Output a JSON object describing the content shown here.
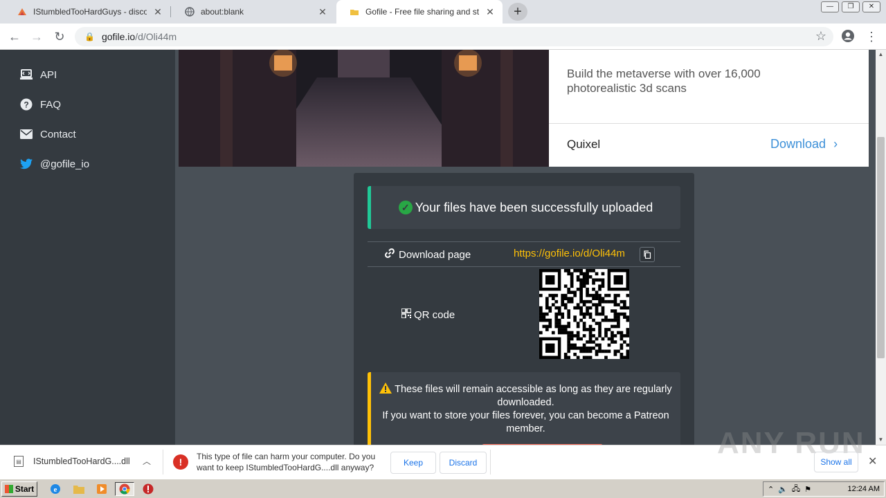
{
  "browser": {
    "tabs": [
      {
        "title": "IStumbledTooHardGuys - discord.gg",
        "favicon": "anyrun-icon",
        "active": false
      },
      {
        "title": "about:blank",
        "favicon": "globe-icon",
        "active": false
      },
      {
        "title": "Gofile - Free file sharing and storage",
        "favicon": "gofile-icon",
        "active": true
      }
    ],
    "newtab_label": "+",
    "url_host": "gofile.io",
    "url_path": "/d/Oli44m"
  },
  "sidebar": {
    "items": [
      {
        "label": "API",
        "icon": "laptop-icon"
      },
      {
        "label": "FAQ",
        "icon": "question-icon"
      },
      {
        "label": "Contact",
        "icon": "envelope-icon"
      },
      {
        "label": "@gofile_io",
        "icon": "twitter-icon"
      }
    ]
  },
  "ad": {
    "text": "Build the metaverse with over 16,000 photorealistic 3d scans",
    "brand": "Quixel",
    "cta": "Download"
  },
  "upload": {
    "success_message": "Your files have been successfully uploaded",
    "download_page_label": "Download page",
    "download_url": "https://gofile.io/d/Oli44m",
    "qr_label": "QR code",
    "warning_line1": "These files will remain accessible as long as they are regularly downloaded.",
    "warning_line2": "If you want to store your files forever, you can become a Patreon member."
  },
  "download_bar": {
    "file_name": "IStumbledTooHardG....dll",
    "message": "This type of file can harm your computer. Do you want to keep IStumbledTooHardG....dll anyway?",
    "keep_label": "Keep",
    "discard_label": "Discard",
    "show_all_label": "Show all",
    "watermark": "ANY RUN"
  },
  "taskbar": {
    "start_label": "Start",
    "clock": "12:24 AM"
  },
  "colors": {
    "success_accent": "#20c997",
    "link_yellow": "#ffc107",
    "ad_cta_blue": "#3b8fd8",
    "sidebar_bg": "#343a40",
    "page_bg": "#495057"
  }
}
